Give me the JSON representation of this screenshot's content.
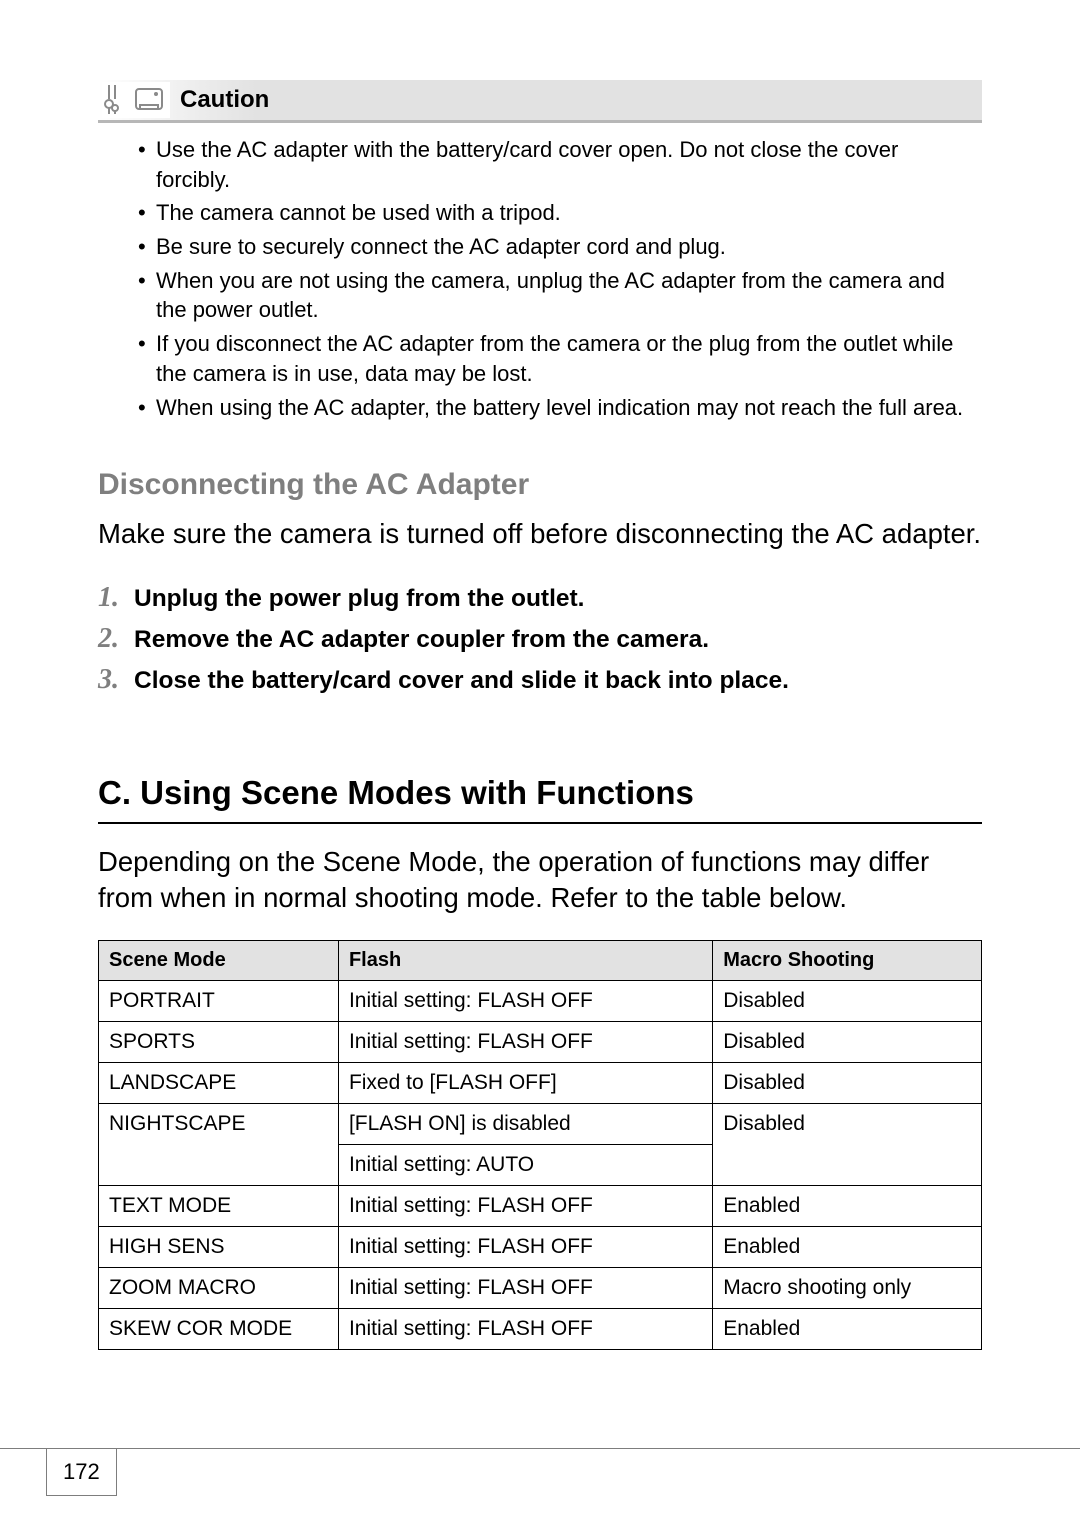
{
  "caution": {
    "title": "Caution",
    "items": [
      "Use the AC adapter with the battery/card cover open. Do not close the cover forcibly.",
      "The camera cannot be used with a tripod.",
      "Be sure to securely connect the AC adapter cord and plug.",
      "When you are not using the camera, unplug the AC adapter from the camera and the power outlet.",
      "If you disconnect the AC adapter from the camera or the plug from the outlet while the camera is in use, data may be lost.",
      "When using the AC adapter, the battery level indication may not reach the full area."
    ]
  },
  "h2": "Disconnecting the AC Adapter",
  "intro": "Make sure the camera is turned off before disconnecting the AC adapter.",
  "steps": [
    {
      "num": "1.",
      "text": "Unplug the power plug from the outlet."
    },
    {
      "num": "2.",
      "text": "Remove the AC adapter coupler from the camera."
    },
    {
      "num": "3.",
      "text": "Close the battery/card cover and slide it back into place."
    }
  ],
  "h1": "C. Using Scene Modes with Functions",
  "p2": "Depending on the Scene Mode, the operation of functions may differ from when in normal shooting mode. Refer to the table below.",
  "table": {
    "headers": [
      "Scene Mode",
      "Flash",
      "Macro Shooting"
    ],
    "rows": [
      {
        "mode": "PORTRAIT",
        "flash": "Initial setting: FLASH OFF",
        "macro": "Disabled"
      },
      {
        "mode": "SPORTS",
        "flash": "Initial setting: FLASH OFF",
        "macro": "Disabled"
      },
      {
        "mode": "LANDSCAPE",
        "flash": "Fixed to [FLASH OFF]",
        "macro": "Disabled"
      },
      {
        "mode": "NIGHTSCAPE",
        "flash": "[FLASH ON] is disabled",
        "macro": "Disabled",
        "flash2": "Initial setting: AUTO"
      },
      {
        "mode": "TEXT MODE",
        "flash": "Initial setting: FLASH OFF",
        "macro": "Enabled"
      },
      {
        "mode": "HIGH SENS",
        "flash": "Initial setting: FLASH OFF",
        "macro": "Enabled"
      },
      {
        "mode": "ZOOM MACRO",
        "flash": "Initial setting: FLASH OFF",
        "macro": "Macro shooting only"
      },
      {
        "mode": "SKEW COR MODE",
        "flash": "Initial setting: FLASH OFF",
        "macro": "Enabled"
      }
    ]
  },
  "page_number": "172"
}
